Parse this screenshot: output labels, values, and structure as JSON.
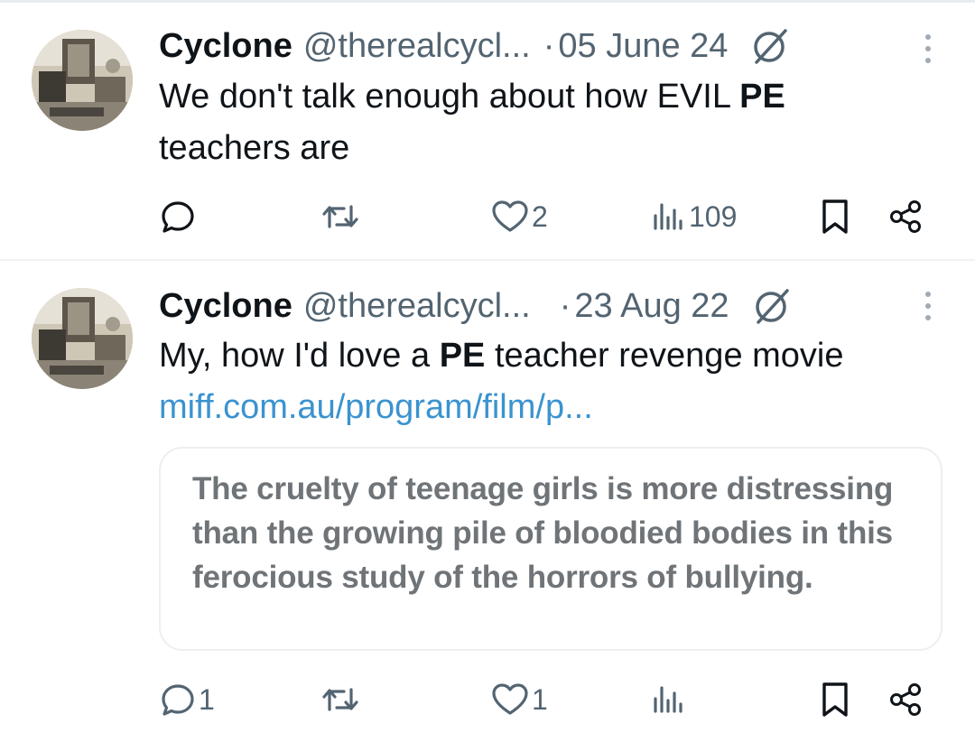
{
  "tweets": [
    {
      "author_name": "Cyclone",
      "handle": "@therealcycl...",
      "separator": "·",
      "date": "05 June 24",
      "text_parts": [
        "We don't talk enough about how EVIL ",
        "PE",
        " teachers are"
      ],
      "actions": {
        "replies": "",
        "retweets": "",
        "likes": "2",
        "views": "109"
      }
    },
    {
      "author_name": "Cyclone",
      "handle": "@therealcycl...",
      "separator": "·",
      "date": "23 Aug 22",
      "text_parts": [
        "My, how I'd love a ",
        "PE",
        " teacher revenge movie"
      ],
      "link": "miff.com.au/program/film/p...",
      "card_text": "The cruelty of teenage girls is more distressing than the growing pile of bloodied bodies in this ferocious study of the horrors of bullying.",
      "actions": {
        "replies": "1",
        "retweets": "",
        "likes": "1",
        "views": ""
      }
    }
  ],
  "icons": {
    "reply": "reply-icon",
    "retweet": "retweet-icon",
    "like": "heart-icon",
    "views": "views-icon",
    "bookmark": "bookmark-icon",
    "share": "share-icon",
    "badge": "circle-slash-icon",
    "more": "more-vertical-icon"
  },
  "colors": {
    "text": "#0f1419",
    "secondary": "#536471",
    "link": "#3b93cf",
    "card_text": "#6f7478"
  }
}
